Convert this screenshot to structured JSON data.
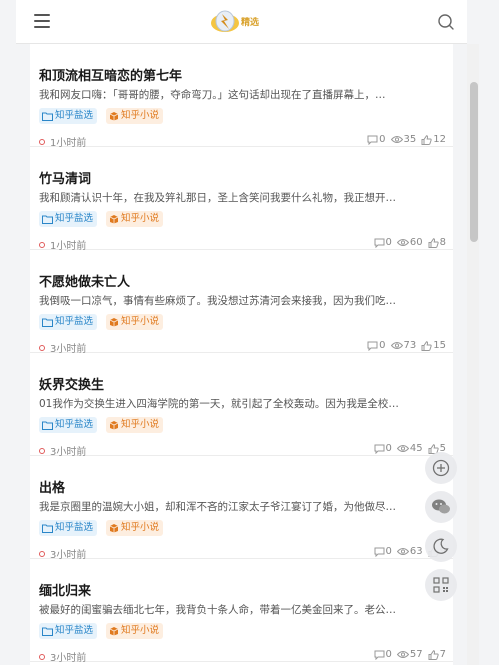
{
  "header": {
    "logo_text": "精选",
    "menu_icon": "hamburger-menu-icon",
    "search_icon": "search-icon"
  },
  "colors": {
    "tag_blue": "#2a86c8",
    "tag_blue_bg": "#e6f2fb",
    "tag_orange": "#e07a1f",
    "tag_orange_bg": "#fdeee0",
    "time_dot": "#e05a5a"
  },
  "articles": [
    {
      "title": "和顶流相互暗恋的第七年",
      "excerpt": "我和网友口嗨：「哥哥的腰，夺命弯刀。」这句话却出现在了直播屏幕上，…",
      "tag1": "知乎盐选",
      "tag2": "知乎小说",
      "time": "1小时前",
      "comments": "0",
      "views": "35",
      "likes": "12"
    },
    {
      "title": "竹马清词",
      "excerpt": "我和顾清认识十年，在我及笄礼那日，圣上含笑问我要什么礼物，我正想开…",
      "tag1": "知乎盐选",
      "tag2": "知乎小说",
      "time": "1小时前",
      "comments": "0",
      "views": "60",
      "likes": "8"
    },
    {
      "title": "不愿她做未亡人",
      "excerpt": "我倒吸一口凉气，事情有些麻烦了。我没想过苏清河会来接我，因为我们吃…",
      "tag1": "知乎盐选",
      "tag2": "知乎小说",
      "time": "3小时前",
      "comments": "0",
      "views": "73",
      "likes": "15"
    },
    {
      "title": "妖界交换生",
      "excerpt": "01我作为交换生进入四海学院的第一天，就引起了全校轰动。因为我是全校…",
      "tag1": "知乎盐选",
      "tag2": "知乎小说",
      "time": "3小时前",
      "comments": "0",
      "views": "45",
      "likes": "5"
    },
    {
      "title": "出格",
      "excerpt": "我是京圈里的温婉大小姐，却和浑不吝的江家太子爷江宴订了婚，为他做尽…",
      "tag1": "知乎盐选",
      "tag2": "知乎小说",
      "time": "3小时前",
      "comments": "0",
      "views": "63",
      "likes": "9"
    },
    {
      "title": "缅北归来",
      "excerpt": "被最好的闺蜜骗去缅北七年，我背负十条人命，带着一亿美金回来了。老公…",
      "tag1": "知乎盐选",
      "tag2": "知乎小说",
      "time": "3小时前",
      "comments": "0",
      "views": "57",
      "likes": "7"
    }
  ],
  "float_buttons": [
    "add-icon",
    "wechat-icon",
    "moon-icon",
    "qrcode-icon"
  ]
}
